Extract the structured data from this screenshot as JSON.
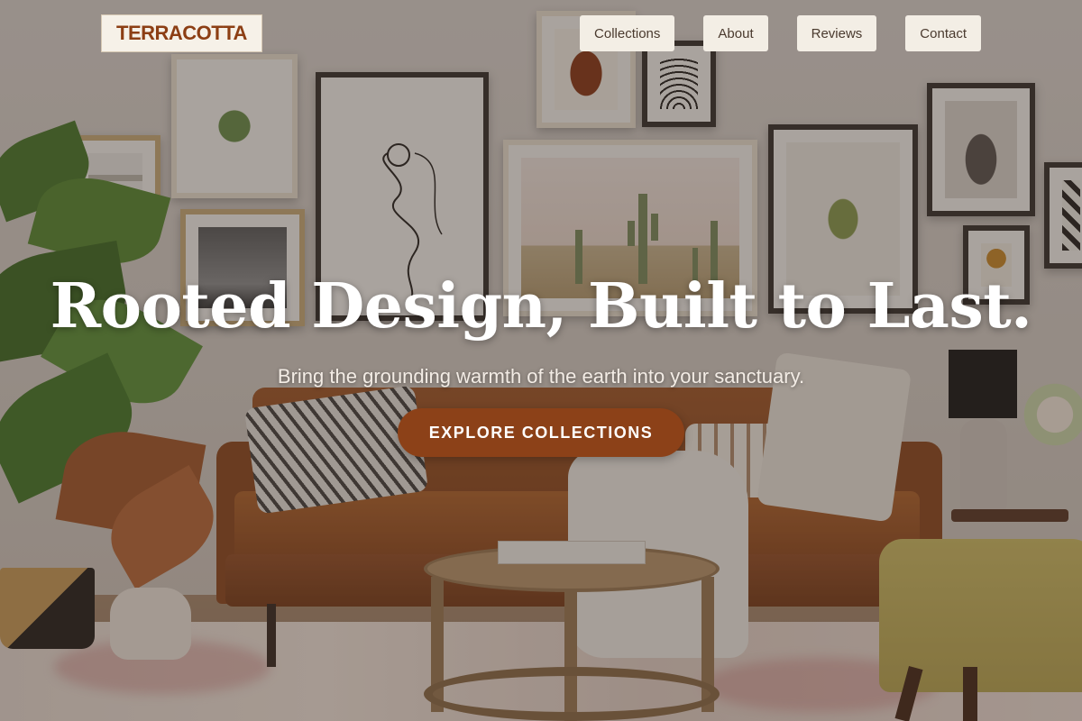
{
  "brand": {
    "logo_text": "TERRACOTTA"
  },
  "nav": {
    "items": [
      {
        "label": "Collections"
      },
      {
        "label": "About"
      },
      {
        "label": "Reviews"
      },
      {
        "label": "Contact"
      }
    ]
  },
  "hero": {
    "title": "Rooted Design, Built to Last.",
    "subtitle": "Bring the grounding warmth of the earth into your sanctuary.",
    "cta_label": "EXPLORE COLLECTIONS",
    "background_image": "living-room-gallery-wall-photo"
  },
  "colors": {
    "accent": "#8c4118",
    "logo_text": "#8c3e14",
    "nav_bg": "#f3eee5",
    "hero_text": "#ffffff"
  }
}
